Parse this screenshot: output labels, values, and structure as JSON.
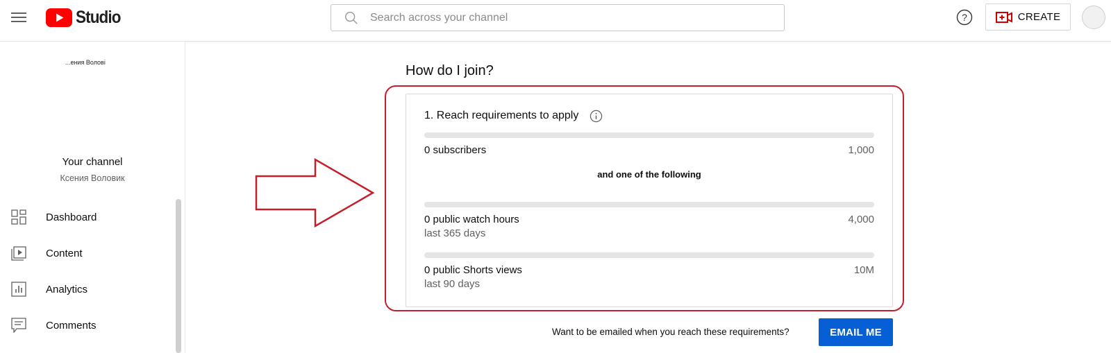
{
  "header": {
    "app_name": "Studio",
    "search_placeholder": "Search across your channel",
    "create_label": "CREATE",
    "brand_color": "#ff0000"
  },
  "sidebar": {
    "banner_text": "...ения Волові",
    "channel_title": "Your channel",
    "channel_name": "Ксения Воловик",
    "items": [
      {
        "label": "Dashboard",
        "icon": "dashboard-icon"
      },
      {
        "label": "Content",
        "icon": "content-icon"
      },
      {
        "label": "Analytics",
        "icon": "analytics-icon"
      },
      {
        "label": "Comments",
        "icon": "comments-icon"
      }
    ]
  },
  "main": {
    "section_title": "How do I join?",
    "card": {
      "title": "1. Reach requirements to apply",
      "requirements": [
        {
          "label": "0 subscribers",
          "sub": "",
          "target": "1,000",
          "progress": 0
        },
        {
          "label": "0 public watch hours",
          "sub": "last 365 days",
          "target": "4,000",
          "progress": 0
        },
        {
          "label": "0 public Shorts views",
          "sub": "last 90 days",
          "target": "10M",
          "progress": 0
        }
      ],
      "or_text": "and one of the following"
    },
    "email_question": "Want to be emailed when you reach these requirements?",
    "email_button": "EMAIL ME",
    "accent_color": "#065fd4",
    "annotation_color": "#c41e2a"
  }
}
